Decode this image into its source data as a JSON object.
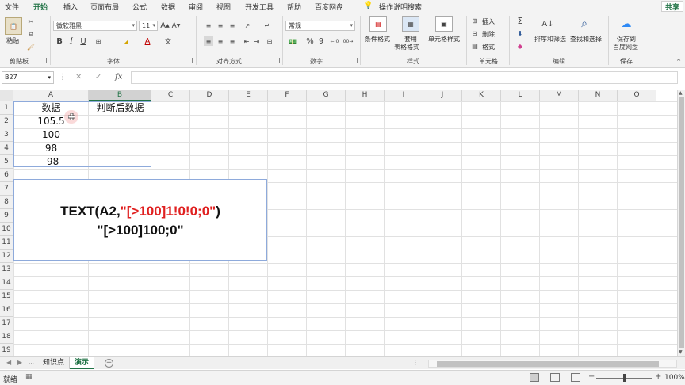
{
  "menu": {
    "items": [
      "文件",
      "开始",
      "插入",
      "页面布局",
      "公式",
      "数据",
      "审阅",
      "视图",
      "开发工具",
      "帮助",
      "百度网盘"
    ],
    "active": "开始",
    "search_placeholder": "操作说明搜索",
    "share": "共享"
  },
  "ribbon": {
    "clipboard": {
      "paste": "粘贴",
      "label": "剪贴板"
    },
    "font": {
      "name": "微软雅黑",
      "size": "11",
      "bold": "B",
      "italic": "I",
      "underline": "U",
      "grow": "A",
      "shrink": "A",
      "label": "字体"
    },
    "alignment": {
      "label": "对齐方式"
    },
    "number": {
      "format": "常规",
      "percent": "%",
      "comma": "9",
      "label": "数字"
    },
    "styles": {
      "conditional": "条件格式",
      "table_line1": "套用",
      "table_line2": "表格格式",
      "cell_styles": "单元格样式",
      "label": "样式"
    },
    "cells": {
      "insert": "插入",
      "delete": "删除",
      "format": "格式",
      "label": "单元格"
    },
    "editing": {
      "sort_filter": "排序和筛选",
      "find_select": "查找和选择",
      "label": "编辑"
    },
    "save": {
      "line1": "保存到",
      "line2": "百度网盘",
      "label": "保存"
    }
  },
  "formula_bar": {
    "name_box": "B27",
    "fx": "fx",
    "cancel": "✕",
    "confirm": "✓",
    "value": ""
  },
  "columns": [
    "A",
    "B",
    "C",
    "D",
    "E",
    "F",
    "G",
    "H",
    "I",
    "J",
    "K",
    "L",
    "M",
    "N",
    "O"
  ],
  "selected_column": "B",
  "rows": [
    "1",
    "2",
    "3",
    "4",
    "5",
    "6",
    "7",
    "8",
    "9",
    "10",
    "11",
    "12",
    "13",
    "14",
    "15",
    "16",
    "17",
    "18",
    "19"
  ],
  "cells": {
    "A1": "数据",
    "B1": "判断后数据",
    "A2": "105.5",
    "A3": "100",
    "A4": "98",
    "A5": "-98"
  },
  "overlay": {
    "formula_prefix": "TEXT(A2,",
    "formula_format": "\"[>100]1!0!0;0\"",
    "formula_suffix": ")",
    "result_format": "\"[>100]100;0\""
  },
  "sheets": [
    "知识点",
    "演示"
  ],
  "active_sheet": "演示",
  "status": {
    "mode": "就绪",
    "zoom": "100%"
  },
  "colors": {
    "accent": "#217346",
    "highlight_red": "#e02020",
    "table_border": "#8eaadb"
  }
}
